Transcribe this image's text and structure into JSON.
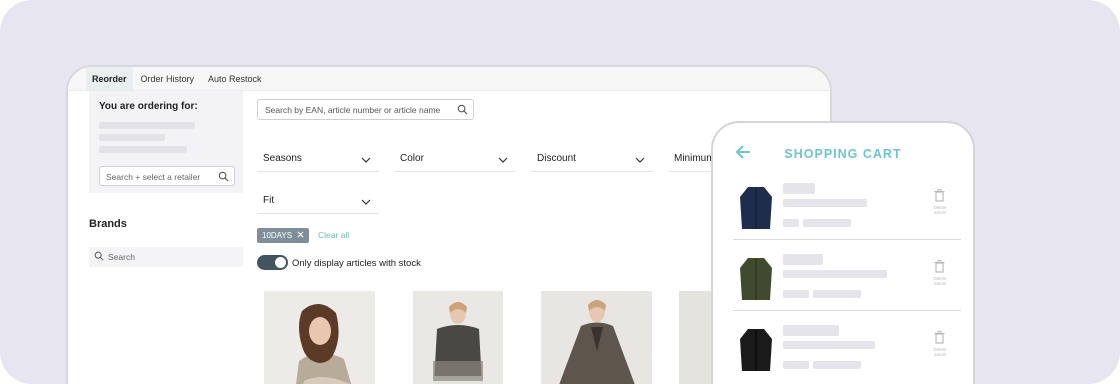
{
  "tabs": [
    {
      "label": "Reorder",
      "active": true
    },
    {
      "label": "Order History",
      "active": false
    },
    {
      "label": "Auto Restock",
      "active": false
    }
  ],
  "left_panel": {
    "title": "You are ordering for:",
    "retailer_search_placeholder": "Search + select a retailer"
  },
  "brands": {
    "title": "Brands",
    "search_placeholder": "Search"
  },
  "main_search_placeholder": "Search by EAN, article number or article name",
  "filters": [
    {
      "label": "Seasons"
    },
    {
      "label": "Color"
    },
    {
      "label": "Discount"
    },
    {
      "label": "Minimum"
    },
    {
      "label": "Fit"
    }
  ],
  "active_filter_chip": "10DAYS",
  "clear_all_label": "Clear all",
  "stock_toggle": {
    "label": "Only display articles with stock",
    "on": true
  },
  "products": [
    {
      "image": "woman-beige-knit-outfit"
    },
    {
      "image": "woman-gradient-shirt-dress"
    },
    {
      "image": "woman-brown-cape-coat"
    },
    {
      "image": "product-partial"
    }
  ],
  "cart": {
    "title": "SHOPPING CART",
    "delete_label": "Delete article",
    "items": [
      {
        "image": "navy-jacket",
        "color": "#1f2d4d"
      },
      {
        "image": "olive-jacket",
        "color": "#3f4a2e"
      },
      {
        "image": "black-jacket",
        "color": "#1b1b1c"
      }
    ]
  },
  "colors": {
    "accent": "#6cc6cc",
    "toggle_track": "#415560",
    "chip_bg": "#7e8f9a",
    "background": "#e7e6f0"
  }
}
